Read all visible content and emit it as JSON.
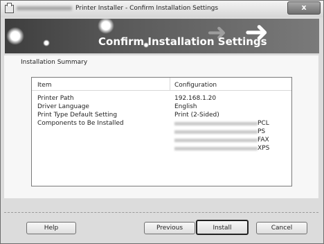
{
  "window": {
    "title": "Printer Installer - Confirm Installation Settings",
    "close_glyph": "x"
  },
  "banner": {
    "title": "Confirm Installation Settings"
  },
  "summary": {
    "label": "Installation Summary",
    "columns": [
      "Item",
      "Configuration"
    ],
    "rows": [
      {
        "item": "Printer Path",
        "config": "192.168.1.20"
      },
      {
        "item": "Driver Language",
        "config": "English"
      },
      {
        "item": "Print Type Default Setting",
        "config": "Print (2-Sided)"
      },
      {
        "item": "Components to Be Installed",
        "config": ""
      }
    ],
    "components": [
      "PCL",
      "PS",
      "FAX",
      "XPS"
    ]
  },
  "buttons": {
    "help": "Help",
    "previous": "Previous",
    "install": "Install",
    "cancel": "Cancel"
  },
  "icons": {
    "app": "printer-installer-icon",
    "close": "close-icon",
    "arrows": "forward-arrow-icon"
  }
}
